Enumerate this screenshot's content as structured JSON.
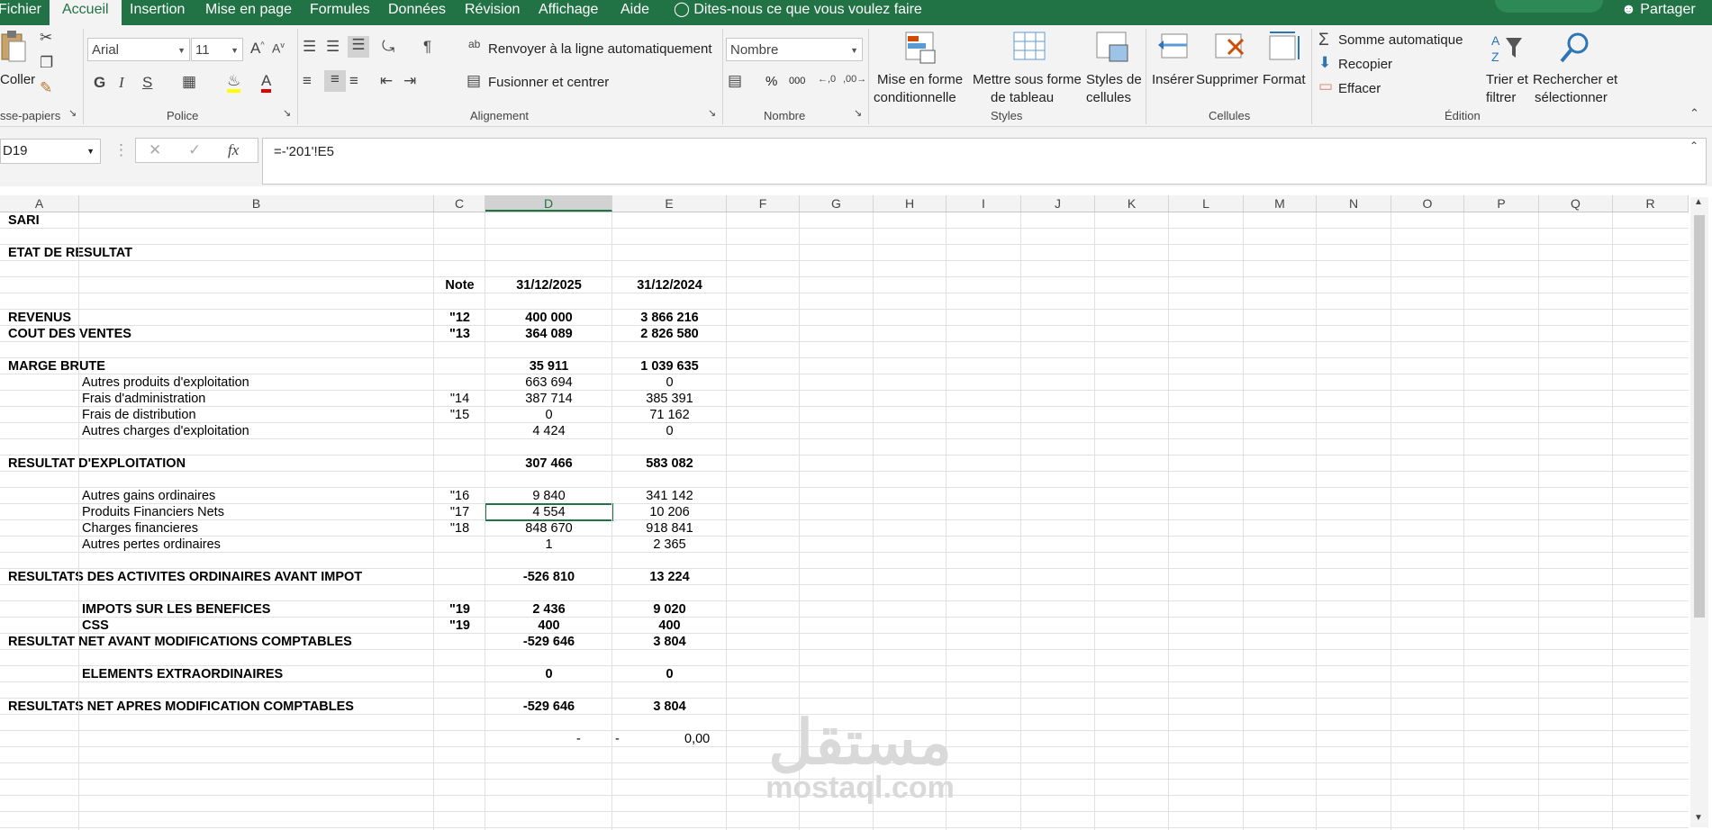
{
  "tabs": [
    "Fichier",
    "Accueil",
    "Insertion",
    "Mise en page",
    "Formules",
    "Données",
    "Révision",
    "Affichage",
    "Aide"
  ],
  "tell_me": "Dites-nous ce que vous voulez faire",
  "share": "Partager",
  "ribbon": {
    "paste_label": "Coller",
    "clipboard_label": "sse-papiers",
    "font_name": "Arial",
    "font_size": "11",
    "police_label": "Police",
    "wrap_text": "Renvoyer à la ligne automatiquement",
    "merge_center": "Fusionner et centrer",
    "alignment_label": "Alignement",
    "number_format": "Nombre",
    "number_label": "Nombre",
    "conditional_format": [
      "Mise en forme",
      "conditionnelle"
    ],
    "format_table": [
      "Mettre sous forme",
      "de tableau"
    ],
    "cell_styles": [
      "Styles de",
      "cellules"
    ],
    "styles_label": "Styles",
    "insert": "Insérer",
    "delete": "Supprimer",
    "format": "Format",
    "cells_label": "Cellules",
    "autosum": "Somme automatique",
    "fill": "Recopier",
    "clear": "Effacer",
    "sort_filter": [
      "Trier et",
      "filtrer"
    ],
    "find_select": [
      "Rechercher et",
      "sélectionner"
    ],
    "edition_label": "Édition",
    "percent": "%",
    "thousands": "000"
  },
  "formula_bar": {
    "name_box": "D19",
    "formula": "=-'201'!E5"
  },
  "columns": [
    "A",
    "B",
    "C",
    "D",
    "E",
    "F",
    "G",
    "H",
    "I",
    "J",
    "K",
    "L",
    "M",
    "N",
    "O",
    "P",
    "Q",
    "R"
  ],
  "cells": [
    {
      "row": 1,
      "a": "SARI",
      "bold": true
    },
    {
      "row": 3,
      "a": "ETAT DE RESULTAT",
      "bold": true
    },
    {
      "row": 5,
      "c": "Note",
      "d": "31/12/2025",
      "e": "31/12/2024",
      "bold": true
    },
    {
      "row": 7,
      "a": "REVENUS",
      "c": "\"12",
      "d": "400 000",
      "e": "3 866 216",
      "bold": true
    },
    {
      "row": 8,
      "a": "COUT DES VENTES",
      "c": "\"13",
      "d": "364 089",
      "e": "2 826 580",
      "bold": true
    },
    {
      "row": 10,
      "a": "MARGE BRUTE",
      "d": "35 911",
      "e": "1 039 635",
      "bold": true
    },
    {
      "row": 11,
      "b": "Autres produits d'exploitation",
      "d": "663 694",
      "e": "0"
    },
    {
      "row": 12,
      "b": "Frais d'administration",
      "c": "\"14",
      "d": "387 714",
      "e": "385 391"
    },
    {
      "row": 13,
      "b": "Frais de distribution",
      "c": "\"15",
      "d": "0",
      "e": "71 162"
    },
    {
      "row": 14,
      "b": "Autres charges d'exploitation",
      "d": "4 424",
      "e": "0"
    },
    {
      "row": 16,
      "a": "RESULTAT D'EXPLOITATION",
      "d": "307 466",
      "e": "583 082",
      "bold": true
    },
    {
      "row": 18,
      "b": "Autres gains ordinaires",
      "c": "\"16",
      "d": "9 840",
      "e": "341 142"
    },
    {
      "row": 19,
      "b": "Produits Financiers Nets",
      "c": "\"17",
      "d": "4 554",
      "e": "10 206"
    },
    {
      "row": 20,
      "b": "Charges financieres",
      "c": "\"18",
      "d": "848 670",
      "e": "918 841"
    },
    {
      "row": 21,
      "b": "Autres pertes ordinaires",
      "d": "1",
      "e": "2 365"
    },
    {
      "row": 23,
      "a": "RESULTATS DES ACTIVITES ORDINAIRES AVANT IMPOT",
      "d": "-526 810",
      "e": "13 224",
      "bold": true
    },
    {
      "row": 25,
      "b": "IMPOTS SUR LES BENEFICES",
      "c": "\"19",
      "d": "2 436",
      "e": "9 020",
      "bold": true
    },
    {
      "row": 26,
      "b": "CSS",
      "c": "\"19",
      "d": "400",
      "e": "400",
      "bold": true
    },
    {
      "row": 27,
      "a": "RESULTAT NET  AVANT MODIFICATIONS COMPTABLES",
      "d": "-529 646",
      "e": "3 804",
      "bold": true
    },
    {
      "row": 29,
      "b": "ELEMENTS EXTRAORDINAIRES",
      "d": "0",
      "e": "0",
      "bold": true
    },
    {
      "row": 31,
      "a": "RESULTATS NET APRES MODIFICATION COMPTABLES",
      "d": "-529 646",
      "e": "3 804",
      "bold": true
    },
    {
      "row": 33,
      "d_right": "-",
      "e_left": "-",
      "e_right": "0,00"
    }
  ],
  "watermark": {
    "arabic": "مستقل",
    "url": "mostaql.com"
  },
  "colors": {
    "accent": "#217346",
    "ribbon_bg": "#f3f3f3"
  }
}
